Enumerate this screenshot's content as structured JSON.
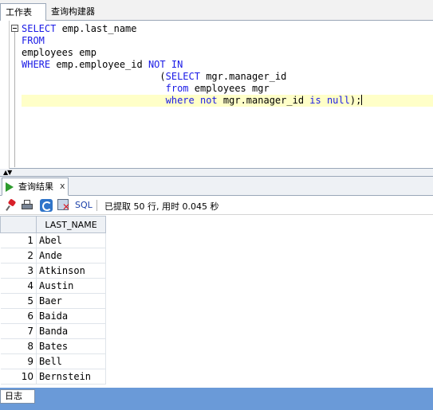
{
  "tabs": {
    "worksheet": "工作表",
    "query_builder": "查询构建器"
  },
  "editor": {
    "lines": [
      [
        {
          "t": "SELECT",
          "kw": true
        },
        {
          "t": " emp.last_name",
          "kw": false
        }
      ],
      [
        {
          "t": "FROM",
          "kw": true
        }
      ],
      [
        {
          "t": "employees emp",
          "kw": false
        }
      ],
      [
        {
          "t": "WHERE",
          "kw": true
        },
        {
          "t": " emp.employee_id ",
          "kw": false
        },
        {
          "t": "NOT IN",
          "kw": true
        }
      ],
      [
        {
          "t": "                        (",
          "kw": false
        },
        {
          "t": "SELECT",
          "kw": true
        },
        {
          "t": " mgr.manager_id",
          "kw": false
        }
      ],
      [
        {
          "t": "                         ",
          "kw": false
        },
        {
          "t": "from",
          "kw": true
        },
        {
          "t": " employees mgr",
          "kw": false
        }
      ],
      [
        {
          "t": "                         ",
          "kw": false
        },
        {
          "t": "where",
          "kw": true
        },
        {
          "t": " ",
          "kw": false
        },
        {
          "t": "not",
          "kw": true
        },
        {
          "t": " mgr.manager_id ",
          "kw": false
        },
        {
          "t": "is",
          "kw": true
        },
        {
          "t": " ",
          "kw": false
        },
        {
          "t": "null",
          "kw": true
        },
        {
          "t": ");",
          "kw": false
        }
      ]
    ],
    "current_line": 6
  },
  "results_panel": {
    "tab_label": "查询结果",
    "tab_close": "x",
    "sql_label": "SQL",
    "status": "已提取 50 行, 用时 0.045 秒"
  },
  "grid": {
    "column_header": "LAST_NAME",
    "rows": [
      {
        "n": "1",
        "v": "Abel"
      },
      {
        "n": "2",
        "v": "Ande"
      },
      {
        "n": "3",
        "v": "Atkinson"
      },
      {
        "n": "4",
        "v": "Austin"
      },
      {
        "n": "5",
        "v": "Baer"
      },
      {
        "n": "6",
        "v": "Baida"
      },
      {
        "n": "7",
        "v": "Banda"
      },
      {
        "n": "8",
        "v": "Bates"
      },
      {
        "n": "9",
        "v": "Bell"
      },
      {
        "n": "10",
        "v": "Bernstein"
      }
    ]
  },
  "log_tab": "日志",
  "colors": {
    "keyword": "#1a1ae6",
    "current_line": "#ffffc8",
    "log_bar": "#6a9ad8"
  },
  "icons": [
    "pin-icon",
    "print-icon",
    "refresh-icon",
    "delete-icon",
    "play-icon",
    "fold-collapse-icon"
  ]
}
